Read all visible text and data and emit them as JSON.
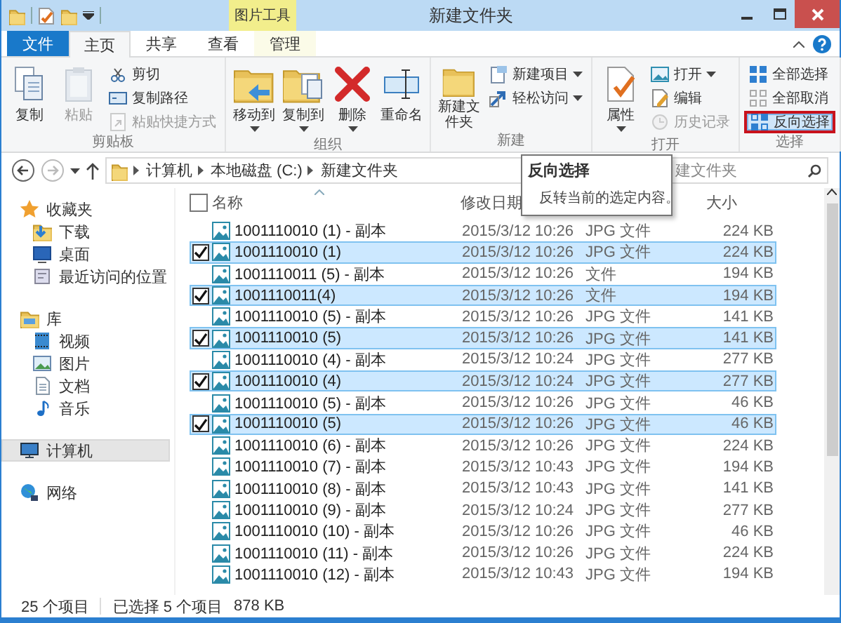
{
  "window": {
    "title": "新建文件夹",
    "context_tab_group": "图片工具"
  },
  "tabs": [
    {
      "label": "文件",
      "kind": "file",
      "selected": false
    },
    {
      "label": "主页",
      "kind": "tab",
      "selected": true
    },
    {
      "label": "共享",
      "kind": "tab",
      "selected": false
    },
    {
      "label": "查看",
      "kind": "tab",
      "selected": false
    },
    {
      "label": "管理",
      "kind": "context",
      "selected": false
    }
  ],
  "ribbon": [
    {
      "label": "剪贴板",
      "items": [
        {
          "label": "复制",
          "kind": "large",
          "disabled": false,
          "dropdown": false,
          "highlighted": false
        },
        {
          "label": "粘贴",
          "kind": "large",
          "disabled": true,
          "dropdown": false,
          "highlighted": false
        },
        {
          "label": "剪切",
          "kind": "small",
          "disabled": false,
          "dropdown": false,
          "highlighted": false
        },
        {
          "label": "复制路径",
          "kind": "small",
          "disabled": false,
          "dropdown": false,
          "highlighted": false
        },
        {
          "label": "粘贴快捷方式",
          "kind": "small",
          "disabled": true,
          "dropdown": false,
          "highlighted": false
        }
      ]
    },
    {
      "label": "组织",
      "items": [
        {
          "label": "移动到",
          "kind": "large",
          "disabled": false,
          "dropdown": true,
          "highlighted": false
        },
        {
          "label": "复制到",
          "kind": "large",
          "disabled": false,
          "dropdown": true,
          "highlighted": false
        },
        {
          "label": "删除",
          "kind": "large",
          "disabled": false,
          "dropdown": true,
          "highlighted": false
        },
        {
          "label": "重命名",
          "kind": "large",
          "disabled": false,
          "dropdown": false,
          "highlighted": false
        }
      ]
    },
    {
      "label": "新建",
      "items": [
        {
          "label": "新建文件夹",
          "kind": "large",
          "disabled": false,
          "dropdown": false,
          "highlighted": false
        },
        {
          "label": "新建项目",
          "kind": "small",
          "disabled": false,
          "dropdown": true,
          "highlighted": false
        },
        {
          "label": "轻松访问",
          "kind": "small",
          "disabled": false,
          "dropdown": true,
          "highlighted": false
        }
      ]
    },
    {
      "label": "打开",
      "items": [
        {
          "label": "属性",
          "kind": "large",
          "disabled": false,
          "dropdown": true,
          "highlighted": false
        },
        {
          "label": "打开",
          "kind": "small",
          "disabled": false,
          "dropdown": true,
          "highlighted": false
        },
        {
          "label": "编辑",
          "kind": "small",
          "disabled": false,
          "dropdown": false,
          "highlighted": false
        },
        {
          "label": "历史记录",
          "kind": "small",
          "disabled": true,
          "dropdown": false,
          "highlighted": false
        }
      ]
    },
    {
      "label": "选择",
      "items": [
        {
          "label": "全部选择",
          "kind": "small",
          "disabled": false,
          "dropdown": false,
          "highlighted": false
        },
        {
          "label": "全部取消",
          "kind": "small",
          "disabled": false,
          "dropdown": false,
          "highlighted": false
        },
        {
          "label": "反向选择",
          "kind": "small",
          "disabled": false,
          "dropdown": false,
          "highlighted": true
        }
      ]
    }
  ],
  "address": {
    "path": [
      "计算机",
      "本地磁盘 (C:)",
      "新建文件夹"
    ]
  },
  "search": {
    "placeholder": "建文件夹"
  },
  "tooltip": {
    "title": "反向选择",
    "text": "反转当前的选定内容。"
  },
  "sidebar": {
    "items": [
      {
        "label": "收藏夹",
        "selected": false,
        "children": [
          {
            "label": "下载",
            "selected": false
          },
          {
            "label": "桌面",
            "selected": false
          },
          {
            "label": "最近访问的位置",
            "selected": false
          }
        ]
      },
      {
        "label": "库",
        "selected": false,
        "children": [
          {
            "label": "视频",
            "selected": false
          },
          {
            "label": "图片",
            "selected": false
          },
          {
            "label": "文档",
            "selected": false
          },
          {
            "label": "音乐",
            "selected": false
          }
        ]
      },
      {
        "label": "计算机",
        "selected": true
      },
      {
        "label": "网络",
        "selected": false
      }
    ]
  },
  "files": {
    "columns": [
      "名称",
      "修改日期",
      "大小"
    ],
    "header_checked": false,
    "rows": [
      {
        "name": "1001110010 (1) - 副本",
        "date": "2015/3/12 10:26",
        "type": "JPG 文件",
        "size": "224 KB",
        "selected": false
      },
      {
        "name": "1001110010 (1)",
        "date": "2015/3/12 10:26",
        "type": "JPG 文件",
        "size": "224 KB",
        "selected": true
      },
      {
        "name": "1001110011 (5) - 副本",
        "date": "2015/3/12 10:26",
        "type": "文件",
        "size": "194 KB",
        "selected": false
      },
      {
        "name": "1001110011(4)",
        "date": "2015/3/12 10:26",
        "type": "文件",
        "size": "194 KB",
        "selected": true
      },
      {
        "name": "1001110010 (5) - 副本",
        "date": "2015/3/12 10:26",
        "type": "JPG 文件",
        "size": "141 KB",
        "selected": false
      },
      {
        "name": "1001110010 (5)",
        "date": "2015/3/12 10:26",
        "type": "JPG 文件",
        "size": "141 KB",
        "selected": true
      },
      {
        "name": "1001110010 (4) - 副本",
        "date": "2015/3/12 10:24",
        "type": "JPG 文件",
        "size": "277 KB",
        "selected": false
      },
      {
        "name": "1001110010 (4)",
        "date": "2015/3/12 10:24",
        "type": "JPG 文件",
        "size": "277 KB",
        "selected": true
      },
      {
        "name": "1001110010 (5) - 副本",
        "date": "2015/3/12 10:26",
        "type": "JPG 文件",
        "size": "46 KB",
        "selected": false
      },
      {
        "name": "1001110010 (5)",
        "date": "2015/3/12 10:26",
        "type": "JPG 文件",
        "size": "46 KB",
        "selected": true
      },
      {
        "name": "1001110010 (6) - 副本",
        "date": "2015/3/12 10:26",
        "type": "JPG 文件",
        "size": "224 KB",
        "selected": false
      },
      {
        "name": "1001110010 (7) - 副本",
        "date": "2015/3/12 10:43",
        "type": "JPG 文件",
        "size": "194 KB",
        "selected": false
      },
      {
        "name": "1001110010 (8) - 副本",
        "date": "2015/3/12 10:43",
        "type": "JPG 文件",
        "size": "141 KB",
        "selected": false
      },
      {
        "name": "1001110010 (9) - 副本",
        "date": "2015/3/12 10:24",
        "type": "JPG 文件",
        "size": "277 KB",
        "selected": false
      },
      {
        "name": "1001110010 (10) - 副本",
        "date": "2015/3/12 10:26",
        "type": "JPG 文件",
        "size": "46 KB",
        "selected": false
      },
      {
        "name": "1001110010 (11) - 副本",
        "date": "2015/3/12 10:26",
        "type": "JPG 文件",
        "size": "224 KB",
        "selected": false
      },
      {
        "name": "1001110010 (12) - 副本",
        "date": "2015/3/12 10:43",
        "type": "JPG 文件",
        "size": "194 KB",
        "selected": false
      }
    ]
  },
  "status_bar": {
    "item_count": "25 个项目",
    "selection": "已选择 5 个项目",
    "selection_size": "878 KB"
  }
}
